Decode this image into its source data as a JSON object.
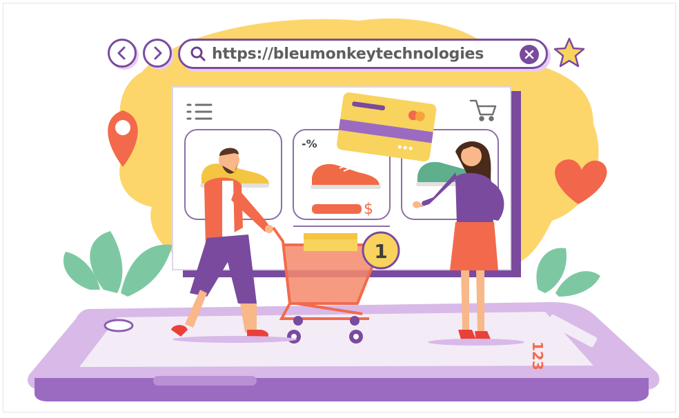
{
  "browser": {
    "url": "https://bleumonkeytechnologies",
    "back_icon": "chevron-left-icon",
    "forward_icon": "chevron-right-icon",
    "search_icon": "search-icon",
    "clear_icon": "close-icon",
    "bookmark_icon": "star-icon"
  },
  "shop": {
    "menu_icon": "menu-icon",
    "cart_icon": "shopping-cart-icon",
    "products": [
      {
        "color": "#f4c542",
        "badge": ""
      },
      {
        "color": "#f06a45",
        "badge": "-%",
        "price_symbol": "$"
      },
      {
        "color": "#5fae8c",
        "badge": ""
      }
    ],
    "cart_count": "1"
  },
  "colors": {
    "accent": "#7a4a9e",
    "blob": "#fdd66b",
    "tablet": "#c9a6dc",
    "screen": "#f2f2f2",
    "orange": "#f26a4b"
  }
}
